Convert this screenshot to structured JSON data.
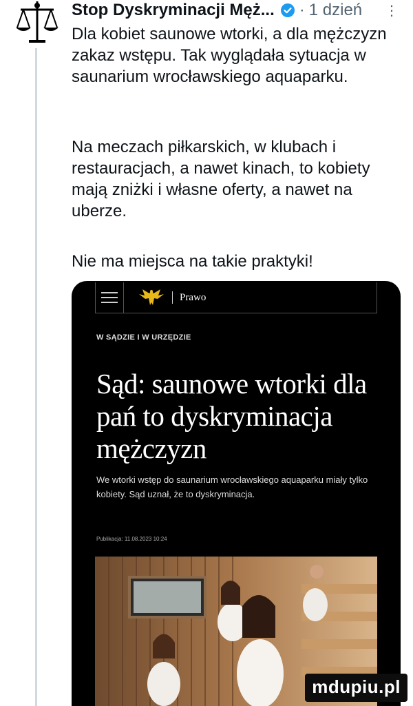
{
  "tweet": {
    "author_name": "Stop Dyskryminacji Męż...",
    "verified": true,
    "separator": "·",
    "time": "1 dzień",
    "more_icon": "more-icon",
    "paragraphs": [
      "Dla kobiet saunowe wtorki, a dla mężczyzn zakaz wstępu. Tak wyglądała sytuacja w saunarium wrocławskiego aquaparku.",
      "Na meczach piłkarskich, w klubach i restauracjach, a nawet kinach, to kobiety mają zniżki i własne oferty, a nawet na uberze.",
      "Nie ma miejsca na takie praktyki!"
    ]
  },
  "article": {
    "nav_menu_icon": "hamburger-icon",
    "nav_logo_icon": "eagle-icon",
    "nav_section": "Prawo",
    "kicker": "W SĄDZIE I W URZĘDZIE",
    "headline": "Sąd: saunowe wtorki dla pań to dyskryminacja mężczyzn",
    "lead": "We wtorki wstęp do saunarium wrocławskiego aquaparku miały tylko kobiety. Sąd uznał, że to dyskryminacja.",
    "published": "Publikacja: 11.08.2023 10:24"
  },
  "watermark": "mdupiu.pl",
  "colors": {
    "accent_blue": "#1d9bf0",
    "muted_text": "#536471",
    "card_background": "#000000"
  }
}
